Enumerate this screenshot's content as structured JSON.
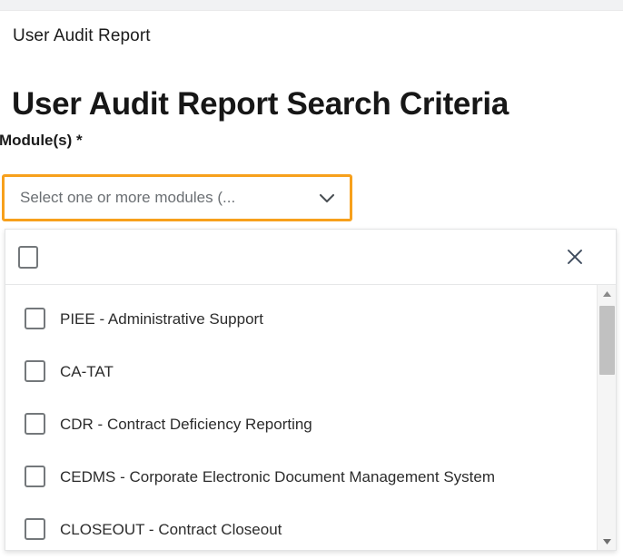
{
  "page": {
    "breadcrumb": "User Audit Report",
    "title": "User Audit Report Search Criteria"
  },
  "form": {
    "module_field": {
      "label": "Module(s) *",
      "placeholder": "Select one or more modules (...",
      "value": "",
      "chevron_icon": "chevron-down-icon",
      "border_color": "#f7a01c"
    }
  },
  "dropdown": {
    "header": {
      "select_all_checkbox": {
        "icon": "checkbox-unchecked-icon",
        "checked": false,
        "label": ""
      },
      "close": {
        "icon": "close-icon",
        "label": ""
      }
    },
    "options": [
      {
        "label": "PIEE - Administrative Support",
        "checked": false
      },
      {
        "label": "CA-TAT",
        "checked": false
      },
      {
        "label": "CDR - Contract Deficiency Reporting",
        "checked": false
      },
      {
        "label": "CEDMS - Corporate Electronic Document Management System",
        "checked": false
      },
      {
        "label": "CLOSEOUT - Contract Closeout",
        "checked": false
      }
    ],
    "scrollbar": {
      "up_icon": "scroll-up-arrow-icon",
      "down_icon": "scroll-down-arrow-icon"
    }
  },
  "colors": {
    "accent_orange": "#f7a01c",
    "text_dark": "#1b1b1b",
    "text_muted": "#6b6f73",
    "checkbox_border": "#74787b",
    "page_bg": "#f1f2f3"
  }
}
